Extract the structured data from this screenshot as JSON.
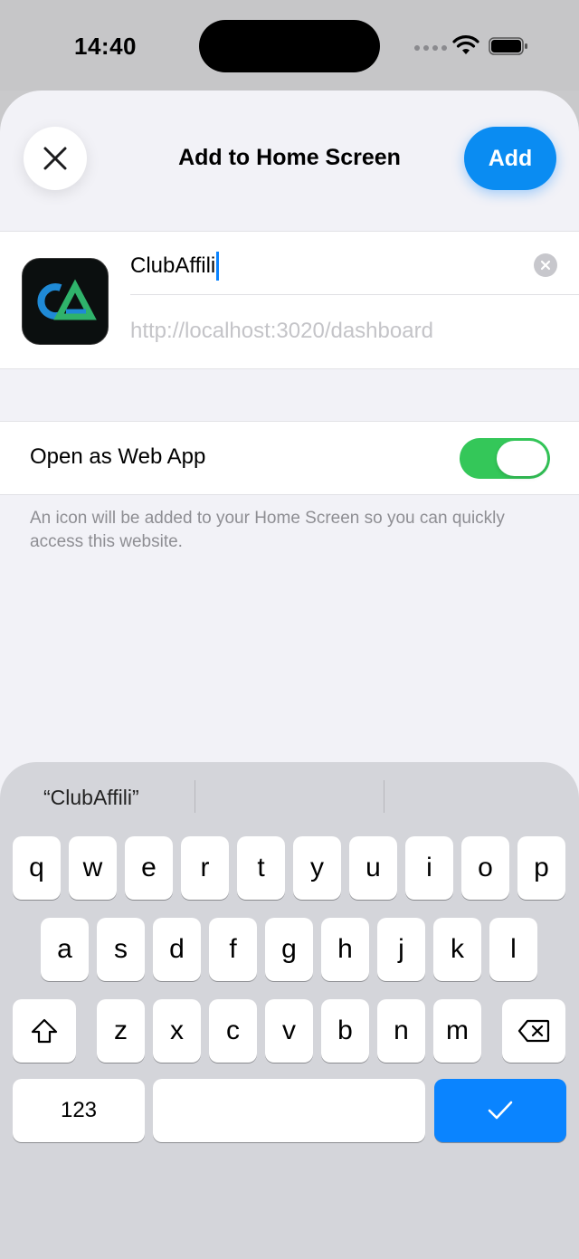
{
  "status_bar": {
    "time": "14:40"
  },
  "sheet": {
    "title": "Add to Home Screen",
    "add_label": "Add",
    "name_value": "ClubAffili",
    "url_value": "http://localhost:3020/dashboard",
    "webapp_label": "Open as Web App",
    "webapp_enabled": true,
    "description": "An icon will be added to your Home Screen so you can quickly access this website."
  },
  "keyboard": {
    "suggestions": [
      "“ClubAffili”",
      "",
      ""
    ],
    "row1": [
      "q",
      "w",
      "e",
      "r",
      "t",
      "y",
      "u",
      "i",
      "o",
      "p"
    ],
    "row2": [
      "a",
      "s",
      "d",
      "f",
      "g",
      "h",
      "j",
      "k",
      "l"
    ],
    "row3": [
      "z",
      "x",
      "c",
      "v",
      "b",
      "n",
      "m"
    ],
    "numbers_label": "123"
  },
  "colors": {
    "accent": "#0a84ff",
    "toggle_on": "#34c759"
  }
}
